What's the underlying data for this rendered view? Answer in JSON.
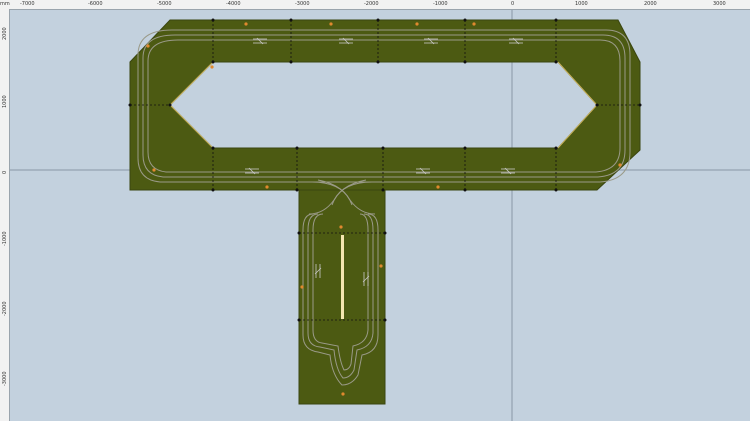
{
  "ruler": {
    "unit": "mm",
    "top_ticks": [
      "-7000",
      "-6000",
      "-5000",
      "-4000",
      "-3000",
      "-2000",
      "-1000",
      "0",
      "1000",
      "2000",
      "3000"
    ],
    "left_ticks": [
      "2000",
      "1000",
      "0",
      "-1000",
      "-2000",
      "-3000"
    ]
  },
  "colors": {
    "background": "#c3d1de",
    "baseboard": "#4c5a12",
    "baseboard_edge": "#3a4510",
    "track": "#9a9a88",
    "marker": "#e0892f",
    "signal_bar": "#f4e6b0",
    "dimension": "#111111"
  }
}
